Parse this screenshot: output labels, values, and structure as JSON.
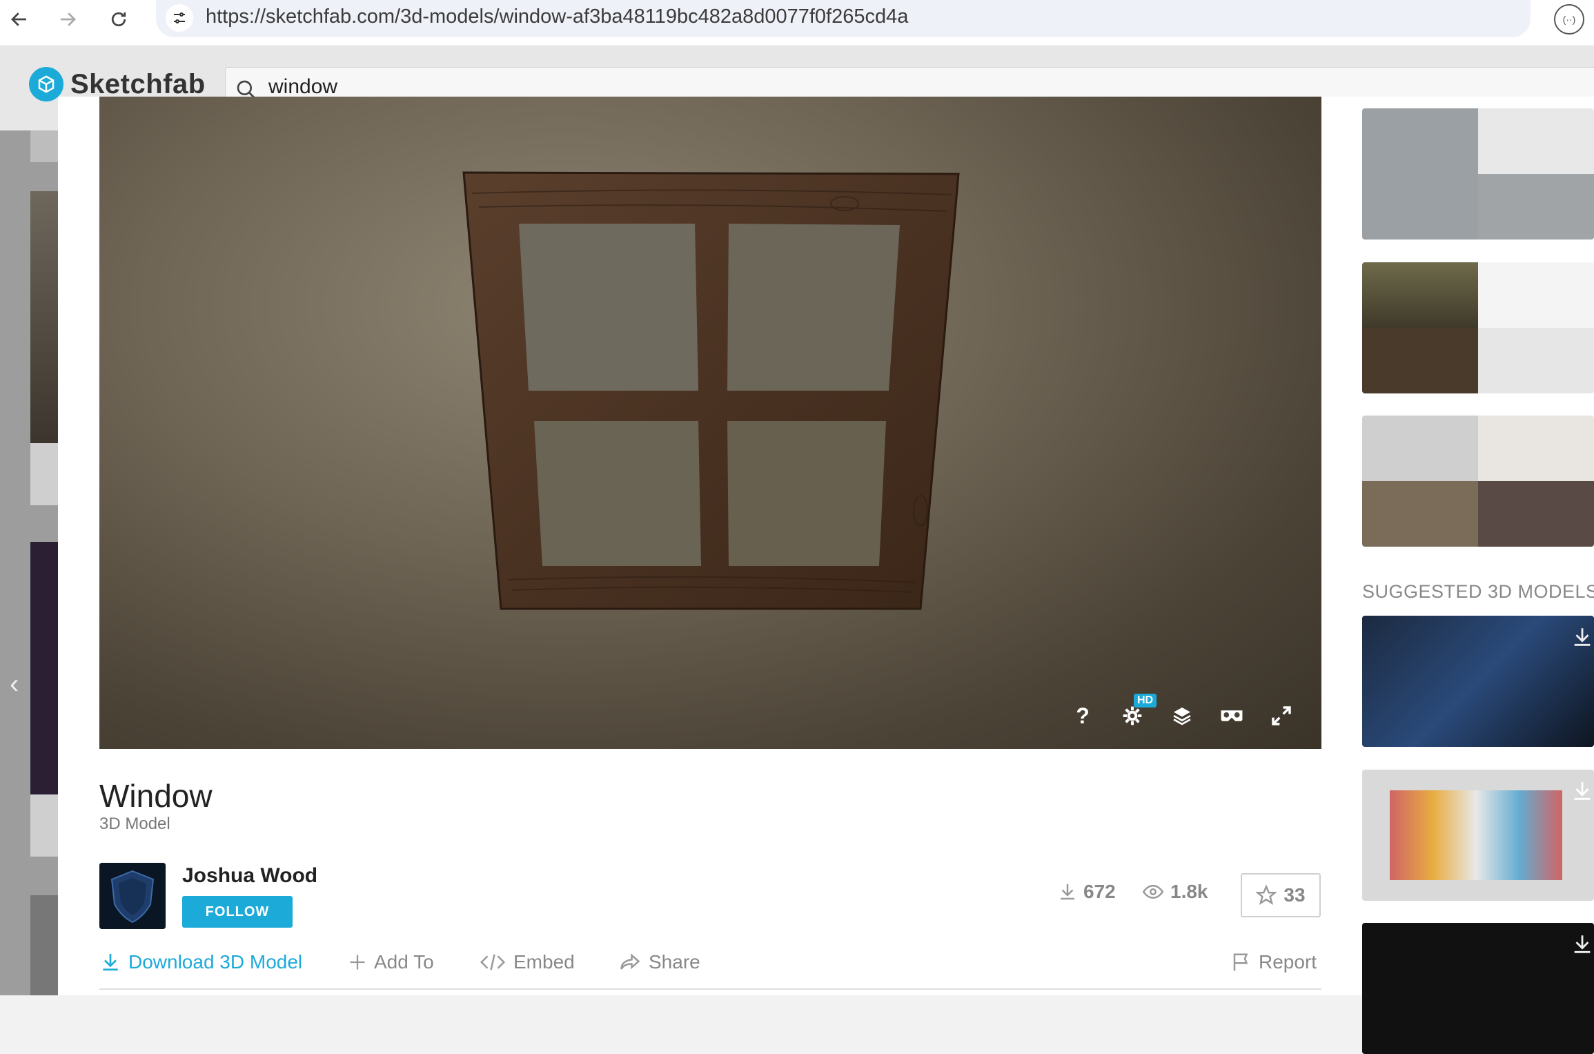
{
  "browser": {
    "url": "https://sketchfab.com/3d-models/window-af3ba48119bc482a8d0077f0f265cd4a",
    "back_icon": "arrow-left-icon",
    "forward_icon": "arrow-right-icon",
    "reload_icon": "reload-icon"
  },
  "site": {
    "brand": "Sketchfab",
    "search_value": "window"
  },
  "model": {
    "title": "Window",
    "type_label": "3D Model",
    "author": "Joshua Wood",
    "follow_label": "FOLLOW",
    "downloads": "672",
    "views": "1.8k",
    "likes": "33",
    "hd_badge": "HD",
    "help_label": "?"
  },
  "actions": {
    "download": "Download 3D Model",
    "add_to": "Add To",
    "embed": "Embed",
    "share": "Share",
    "report": "Report"
  },
  "sidebar": {
    "suggested_heading": "SUGGESTED 3D MODELS"
  },
  "colors": {
    "accent": "#1caad9"
  }
}
